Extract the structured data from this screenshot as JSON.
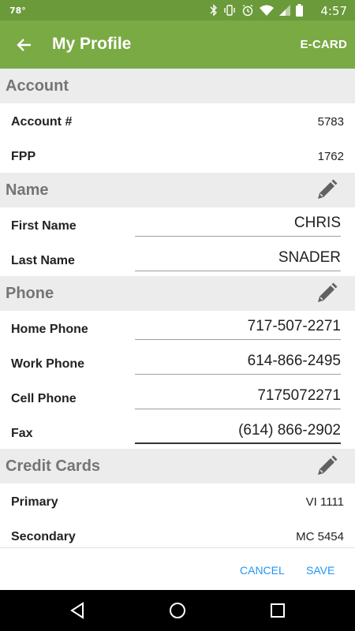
{
  "status": {
    "temperature": "78°",
    "time": "4:57"
  },
  "appbar": {
    "title": "My Profile",
    "ecard_label": "E-CARD"
  },
  "account": {
    "title": "Account",
    "rows": [
      {
        "label": "Account #",
        "value": "5783"
      },
      {
        "label": "FPP",
        "value": "1762"
      }
    ]
  },
  "name": {
    "title": "Name",
    "rows": [
      {
        "label": "First Name",
        "value": "CHRIS"
      },
      {
        "label": "Last Name",
        "value": "SNADER"
      }
    ]
  },
  "phone": {
    "title": "Phone",
    "rows": [
      {
        "label": "Home Phone",
        "value": "717-507-2271"
      },
      {
        "label": "Work Phone",
        "value": "614-866-2495"
      },
      {
        "label": "Cell Phone",
        "value": "7175072271"
      },
      {
        "label": "Fax",
        "value": "(614) 866-2902"
      }
    ]
  },
  "credit_cards": {
    "title": "Credit Cards",
    "rows": [
      {
        "label": "Primary",
        "value": "VI 1111"
      },
      {
        "label": "Secondary",
        "value": "MC 5454"
      }
    ]
  },
  "actions": {
    "cancel_label": "CANCEL",
    "save_label": "SAVE"
  },
  "colors": {
    "statusbar": "#6a9a3a",
    "appbar": "#7aaa44",
    "accent": "#2196f3",
    "section_bg": "#ececec"
  }
}
